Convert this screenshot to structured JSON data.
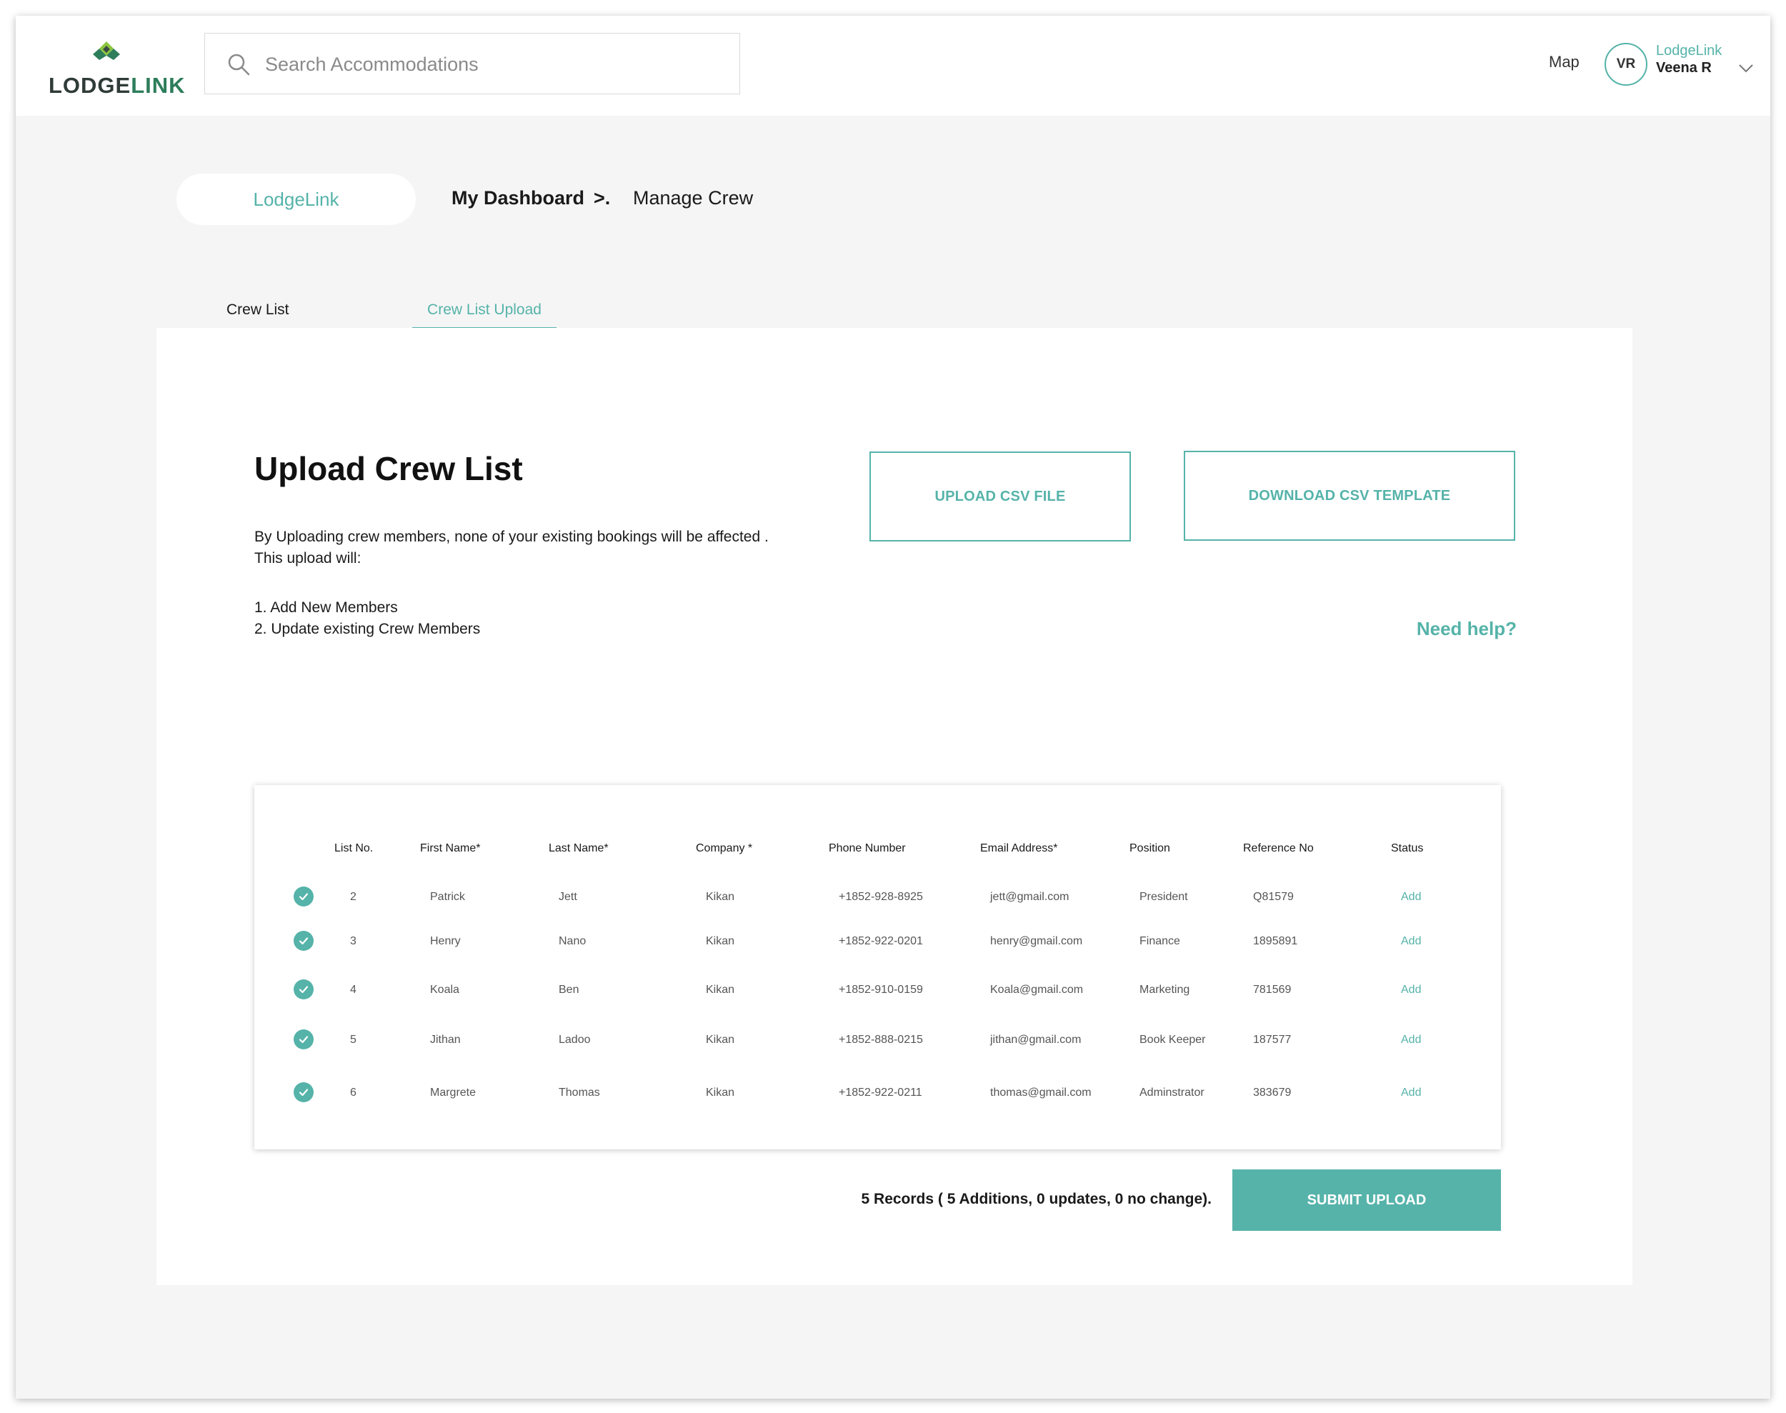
{
  "brand": {
    "logo_part1": "LODGE",
    "logo_part2": "LINK",
    "logo_colors": [
      "#4a4a4a",
      "#2e7d5b",
      "#8cc63f"
    ]
  },
  "search": {
    "placeholder": "Search Accommodations",
    "value": ""
  },
  "nav": {
    "map_label": "Map"
  },
  "user": {
    "initials": "VR",
    "org": "LodgeLink",
    "name": "Veena R"
  },
  "breadcrumb": {
    "home": "LodgeLink",
    "dashboard": "My Dashboard",
    "separator": ">.",
    "current": "Manage Crew"
  },
  "tabs": [
    {
      "label": "Crew List",
      "active": false
    },
    {
      "label": "Crew List Upload",
      "active": true
    }
  ],
  "upload": {
    "title": "Upload Crew List",
    "desc_line1": "By Uploading crew members, none of your existing bookings will be affected .",
    "desc_line2": "This upload will:",
    "step1": "1. Add New Members",
    "step2": "2. Update existing Crew Members",
    "upload_button": "UPLOAD CSV FILE",
    "template_button": "DOWNLOAD CSV TEMPLATE",
    "help_link": "Need help?"
  },
  "table": {
    "headers": [
      "List No.",
      "First Name*",
      "Last Name*",
      "Company *",
      "Phone Number",
      "Email Address*",
      "Position",
      "Reference No",
      "Status"
    ],
    "rows": [
      {
        "list_no": "2",
        "first": "Patrick",
        "last": "Jett",
        "company": "Kikan",
        "phone": "+1852-928-8925",
        "email": "jett@gmail.com",
        "position": "President",
        "ref": "Q81579",
        "status": "Add"
      },
      {
        "list_no": "3",
        "first": "Henry",
        "last": "Nano",
        "company": "Kikan",
        "phone": "+1852-922-0201",
        "email": "henry@gmail.com",
        "position": "Finance",
        "ref": "1895891",
        "status": "Add"
      },
      {
        "list_no": "4",
        "first": "Koala",
        "last": "Ben",
        "company": "Kikan",
        "phone": "+1852-910-0159",
        "email": "Koala@gmail.com",
        "position": "Marketing",
        "ref": "781569",
        "status": "Add"
      },
      {
        "list_no": "5",
        "first": "Jithan",
        "last": "Ladoo",
        "company": "Kikan",
        "phone": "+1852-888-0215",
        "email": "jithan@gmail.com",
        "position": "Book Keeper",
        "ref": "187577",
        "status": "Add"
      },
      {
        "list_no": "6",
        "first": "Margrete",
        "last": "Thomas",
        "company": "Kikan",
        "phone": "+1852-922-0211",
        "email": "thomas@gmail.com",
        "position": "Adminstrator",
        "ref": "383679",
        "status": "Add"
      }
    ]
  },
  "footer": {
    "summary": "5 Records ( 5 Additions, 0 updates, 0 no change).",
    "submit_label": "SUBMIT UPLOAD"
  },
  "colors": {
    "accent": "#55b3a9",
    "background": "#f5f5f5"
  }
}
